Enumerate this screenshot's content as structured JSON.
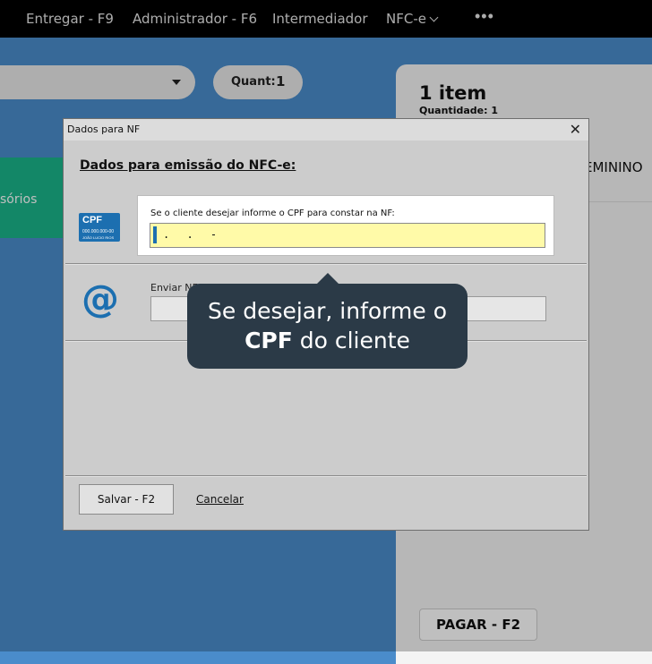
{
  "topbar": {
    "items": [
      "Entregar - F9",
      "Administrador - F6",
      "Intermediador",
      "NFC-e"
    ],
    "more": "•••"
  },
  "quant": {
    "label": "Quant:",
    "value": "1"
  },
  "category": {
    "partial_label": "sórios"
  },
  "cart": {
    "count_label": "1 item",
    "quantity_label": "Quantidade: 1",
    "product_partial": "EMININO",
    "pay_button": "PAGAR - F2"
  },
  "dialog": {
    "title": "Dados para NF",
    "heading": "Dados para emissão do NFC-e:",
    "cpf_icon_text": "CPF",
    "cpf_icon_number": "000.000.000-00",
    "cpf_icon_name": "JOÃO LUCIO RIOS",
    "cpf_label": "Se o cliente desejar informe o CPF para constar na NF:",
    "cpf_mask": ". . -",
    "cpf_value": "",
    "email_label": "Enviar NFC",
    "email_value": "",
    "save_button": "Salvar - F2",
    "cancel_link": "Cancelar"
  },
  "tooltip": {
    "line1": "Se desejar, informe o",
    "line2_bold": "CPF",
    "line2_rest": " do cliente"
  },
  "colors": {
    "background": "#4a8ccb",
    "accent_blue": "#1c6fb0",
    "green": "#1ab58a",
    "tooltip_bg": "#2b3a47",
    "cpf_input_bg": "#fffaa8"
  },
  "icons": [
    "close-icon",
    "chevron-down-icon",
    "more-icon",
    "dropdown-caret-icon",
    "cpf-card-icon",
    "at-email-icon"
  ]
}
